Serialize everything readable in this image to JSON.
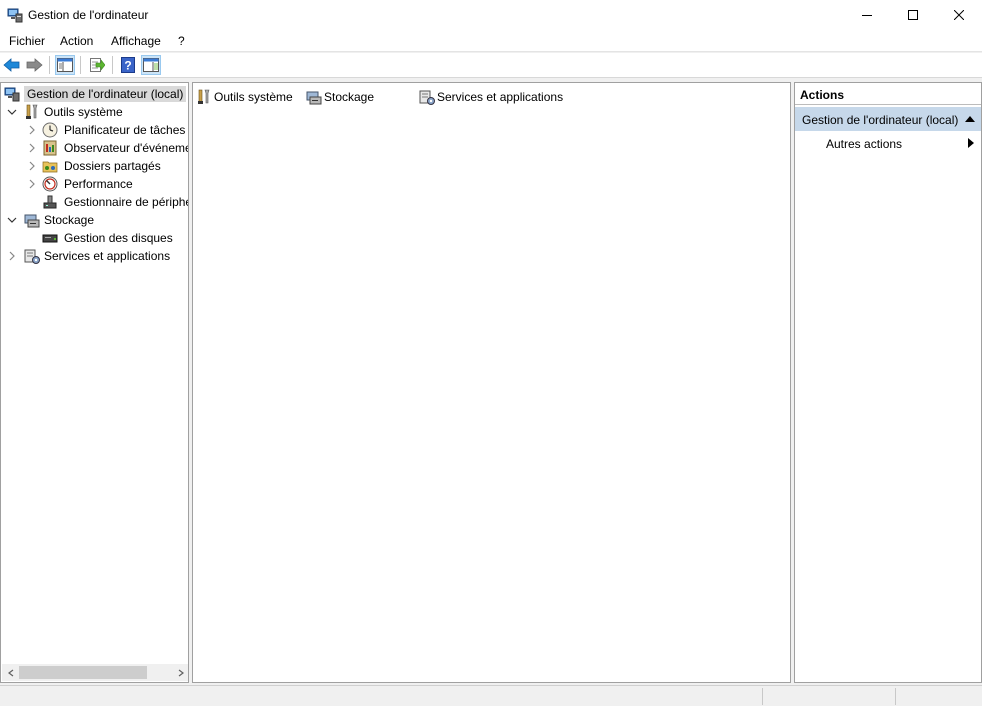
{
  "window": {
    "title": "Gestion de l'ordinateur",
    "min_icon": "minimize-icon",
    "max_icon": "maximize-icon",
    "close_icon": "close-icon"
  },
  "menu": {
    "items": [
      "Fichier",
      "Action",
      "Affichage",
      "?"
    ]
  },
  "toolbar": {
    "buttons": [
      "back-arrow-icon",
      "forward-arrow-icon",
      "show-hide-console-tree-icon",
      "export-list-icon",
      "help-icon",
      "show-hide-action-pane-icon"
    ]
  },
  "tree": {
    "root": "Gestion de l'ordinateur (local)",
    "system_tools": "Outils système",
    "task_scheduler": "Planificateur de tâches",
    "event_viewer": "Observateur d'événeme",
    "shared_folders": "Dossiers partagés",
    "performance": "Performance",
    "device_manager": "Gestionnaire de périphé",
    "storage": "Stockage",
    "disk_management": "Gestion des disques",
    "services_apps": "Services et applications"
  },
  "center": {
    "items": [
      "Outils système",
      "Stockage",
      "Services et applications"
    ]
  },
  "actions": {
    "header": "Actions",
    "section": "Gestion de l'ordinateur (local)",
    "more_actions": "Autres actions"
  },
  "colors": {
    "selection": "#d9d9d9",
    "actions_section_bg": "#c6d8ea",
    "accent_blue": "#1e88d8"
  }
}
